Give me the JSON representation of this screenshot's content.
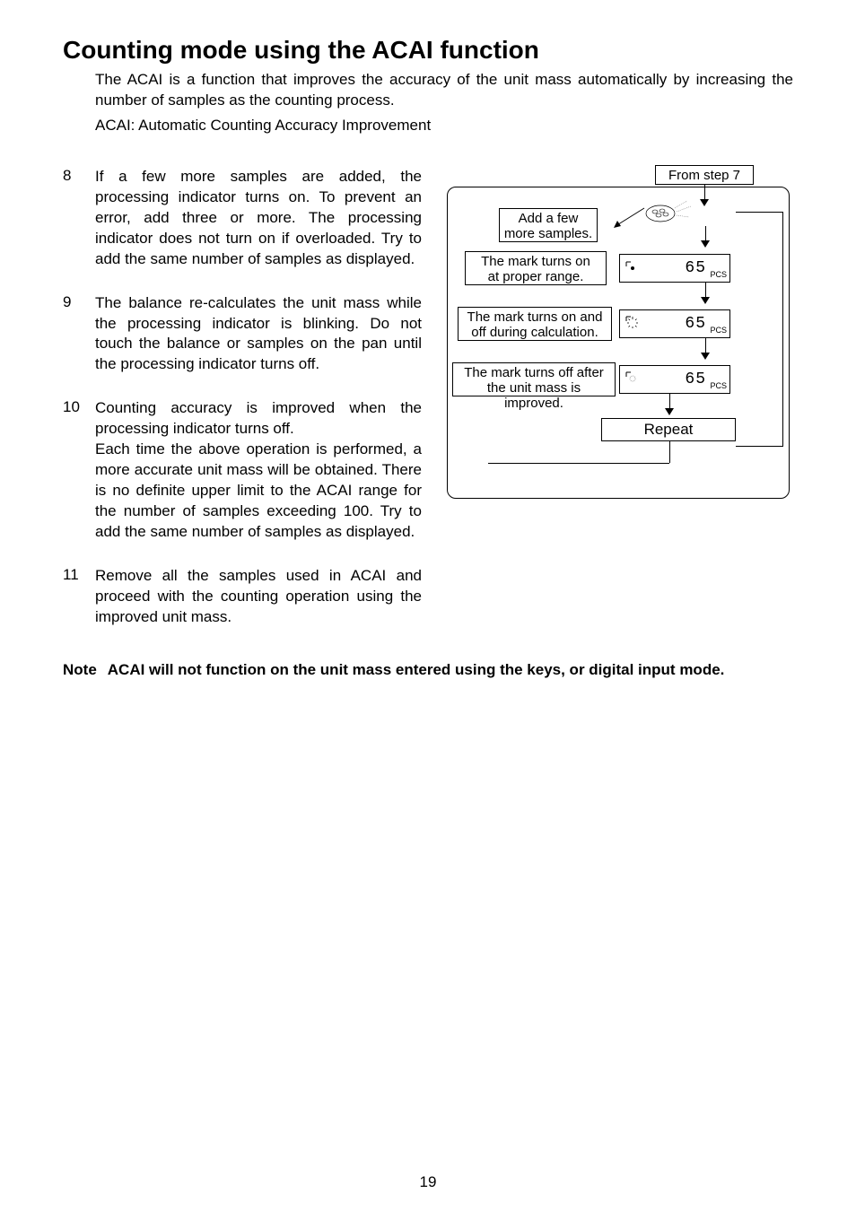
{
  "title": "Counting mode using the ACAI function",
  "intro1": "The ACAI is a function that improves the accuracy of the unit mass automatically by increasing the number of samples as the counting process.",
  "intro2": "ACAI: Automatic Counting Accuracy Improvement",
  "steps": [
    {
      "num": "8",
      "text": "If a few more samples are added, the processing indicator turns on. To prevent an error, add three or more. The processing indicator does not turn on if overloaded. Try to add the same number of samples as displayed."
    },
    {
      "num": "9",
      "text": "The balance re-calculates the unit mass while the processing indicator is blinking. Do not touch the balance or samples on the pan until the processing indicator turns off."
    },
    {
      "num": "10",
      "text": "Counting accuracy is improved when the processing indicator turns off.\nEach time the above operation is performed, a more accurate unit mass will be obtained. There is no definite upper limit to the ACAI range for the number of samples exceeding 100. Try to add the same number of samples as displayed."
    },
    {
      "num": "11",
      "text": "Remove all the samples used in ACAI and proceed with the counting operation using the improved unit mass."
    }
  ],
  "note_label": "Note",
  "note_text": "ACAI will not function on the unit mass entered using the keys, or digital input mode.",
  "page_number": "19",
  "diagram": {
    "from_step": "From step 7",
    "add_samples": "Add a few\nmore samples.",
    "mark_on": "The mark turns on\nat proper range.",
    "mark_blink": "The mark turns on and\noff during calculation.",
    "mark_off": "The mark turns off after\nthe unit mass is improved.",
    "repeat": "Repeat",
    "lcd_value": "65",
    "lcd_unit": "PCS"
  }
}
